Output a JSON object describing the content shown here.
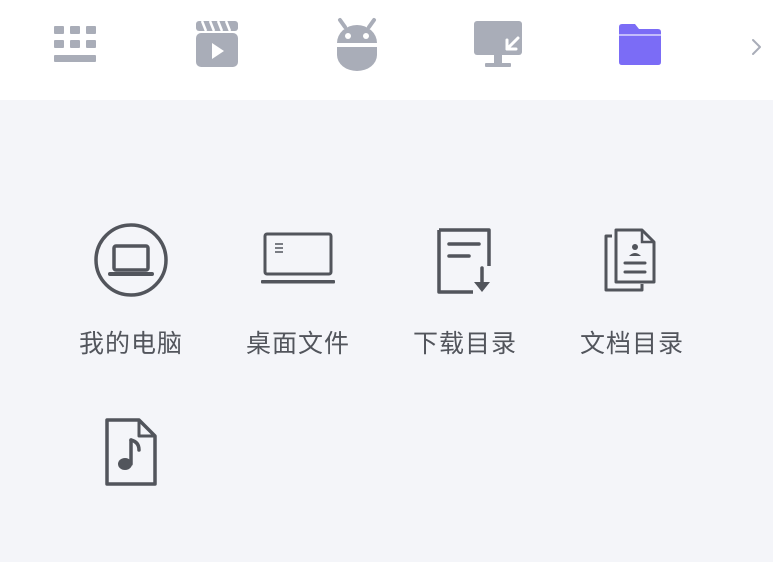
{
  "toolbar": {
    "icons": [
      "keyboard-icon",
      "video-icon",
      "android-icon",
      "remote-desktop-icon",
      "folder-icon",
      "chevron-right-icon"
    ],
    "active_color": "#7b6cf6",
    "inactive_color": "#a9adb8"
  },
  "files": {
    "items": [
      {
        "label": "我的电脑",
        "icon": "computer-icon"
      },
      {
        "label": "桌面文件",
        "icon": "desktop-icon"
      },
      {
        "label": "下载目录",
        "icon": "download-folder-icon"
      },
      {
        "label": "文档目录",
        "icon": "documents-icon"
      },
      {
        "label": "",
        "icon": "music-file-icon"
      }
    ],
    "icon_color": "#52555c"
  }
}
